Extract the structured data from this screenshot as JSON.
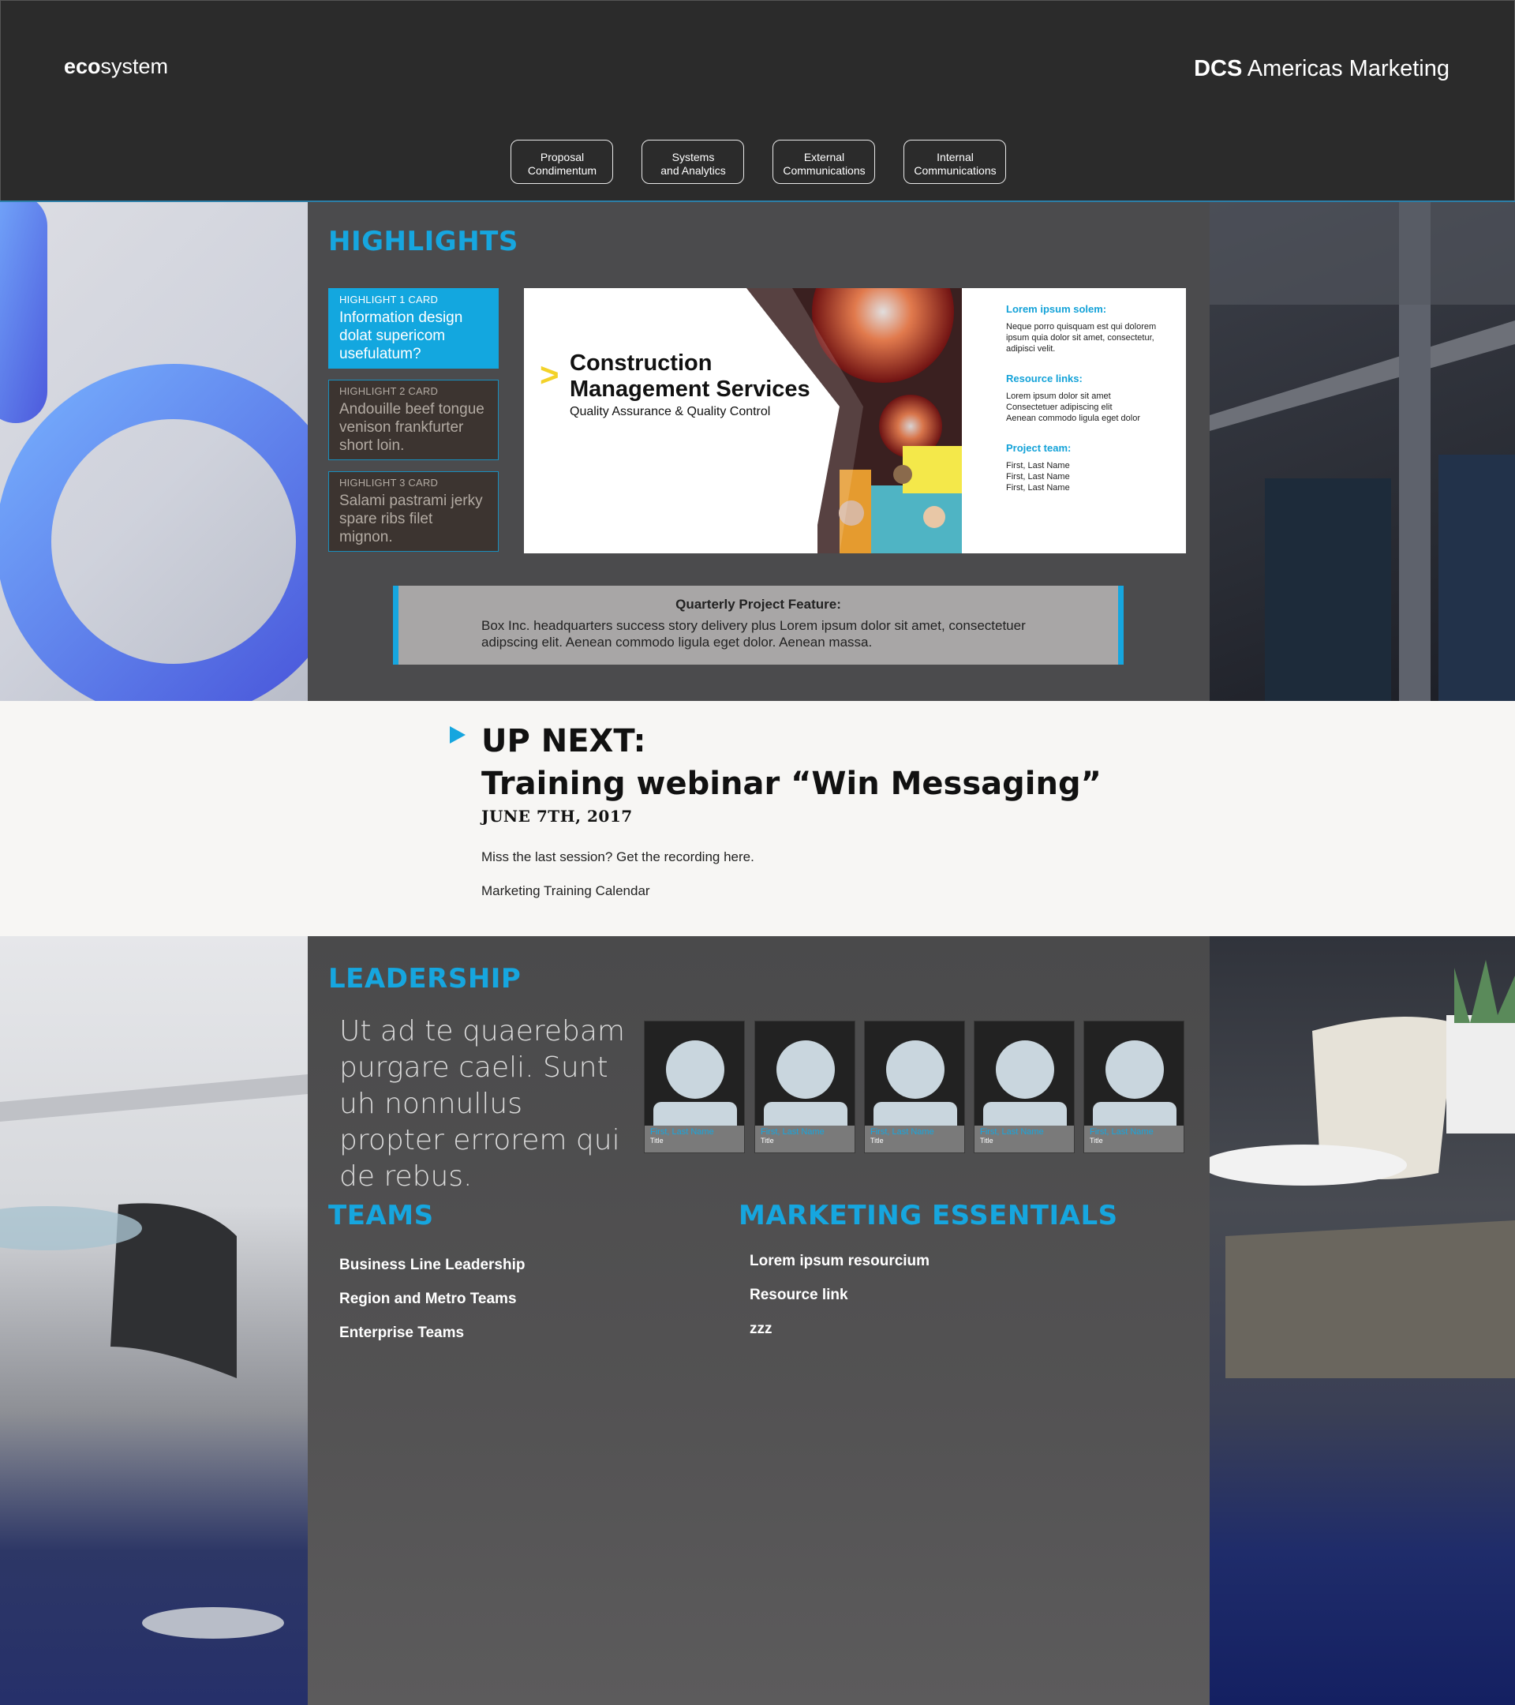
{
  "header": {
    "brand_bold": "eco",
    "brand_light": "system",
    "org_bold": "DCS",
    "org_light": " Americas Marketing",
    "nav": [
      {
        "line1": "Proposal",
        "line2": "Condimentum"
      },
      {
        "line1": "Systems",
        "line2": "and Analytics"
      },
      {
        "line1": "External",
        "line2": "Communications"
      },
      {
        "line1": "Internal",
        "line2": "Communications"
      }
    ]
  },
  "highlights": {
    "title": "HIGHLIGHTS",
    "cards": [
      {
        "label": "HIGHLIGHT 1 CARD",
        "text": "Information design dolat supericom usefulatum?"
      },
      {
        "label": "HIGHLIGHT 2 CARD",
        "text": "Andouille beef tongue venison frankfurter short loin."
      },
      {
        "label": "HIGHLIGHT 3 CARD",
        "text": "Salami pastrami jerky spare ribs filet mignon."
      }
    ],
    "feature": {
      "title_line1": "Construction",
      "title_line2": "Management Services",
      "subtitle": "Quality Assurance & Quality Control",
      "info_heading_1": "Lorem ipsum solem:",
      "info_text_1": "Neque porro quisquam est qui dolorem ipsum quia dolor sit amet, consectetur, adipisci velit.",
      "resources_heading": "Resource links:",
      "resources": [
        "Lorem ipsum dolor sit amet",
        "Consectetuer adipiscing elit",
        "Aenean commodo ligula eget dolor"
      ],
      "team_heading": "Project team:",
      "team": [
        "First, Last Name",
        "First, Last Name",
        "First, Last Name"
      ]
    },
    "quarterly": {
      "title": "Quarterly Project Feature:",
      "body": "Box Inc. headquarters success story delivery plus Lorem ipsum dolor sit amet, consectetuer adipscing elit. Aenean commodo ligula eget dolor. Aenean massa."
    }
  },
  "upnext": {
    "line1": "UP NEXT:",
    "line2": "Training webinar “Win Messaging”",
    "date": "JUNE 7TH, 2017",
    "link1": "Miss the last session? Get the recording here.",
    "link2": "Marketing Training Calendar"
  },
  "leadership": {
    "title": "LEADERSHIP",
    "quote": "Ut ad te quaerebam purgare caeli. Sunt uh nonnullus propter errorem qui de rebus.",
    "people": [
      {
        "name": "First, Last Name",
        "title": "Title"
      },
      {
        "name": "First, Last Name",
        "title": "Title"
      },
      {
        "name": "First, Last Name",
        "title": "Title"
      },
      {
        "name": "First, Last Name",
        "title": "Title"
      },
      {
        "name": "First, Last Name",
        "title": "Title"
      }
    ]
  },
  "teams": {
    "title": "TEAMS",
    "items": [
      "Business Line Leadership",
      "Region and Metro Teams",
      "Enterprise Teams"
    ]
  },
  "essentials": {
    "title": "MARKETING ESSENTIALS",
    "items": [
      "Lorem ipsum resourcium",
      "Resource link",
      "zzz"
    ]
  },
  "colors": {
    "accent": "#16a6df",
    "header_bg": "#2b2b2b",
    "section_bg": "#4b4b4d",
    "upnext_bg": "#f7f6f4"
  }
}
